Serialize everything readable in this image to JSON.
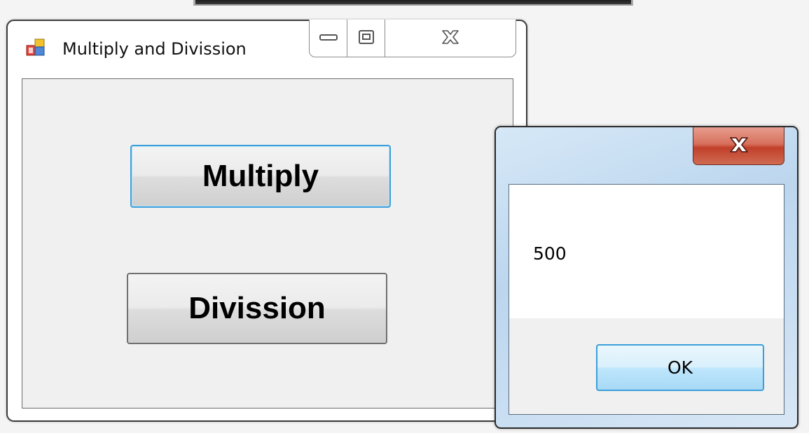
{
  "main_window": {
    "title": "Multiply and Divission",
    "icon": "app-form-icon",
    "caption_buttons": [
      "minimize-icon",
      "maximize-icon",
      "close-icon"
    ],
    "buttons": {
      "multiply_label": "Multiply",
      "division_label": "Divission"
    }
  },
  "message_box": {
    "message": "500",
    "ok_label": "OK",
    "close_icon": "close-icon"
  },
  "colors": {
    "focus_border": "#3c9fd9",
    "close_button_red": "#c1402a",
    "dialog_frame": "#bcd6ee"
  }
}
